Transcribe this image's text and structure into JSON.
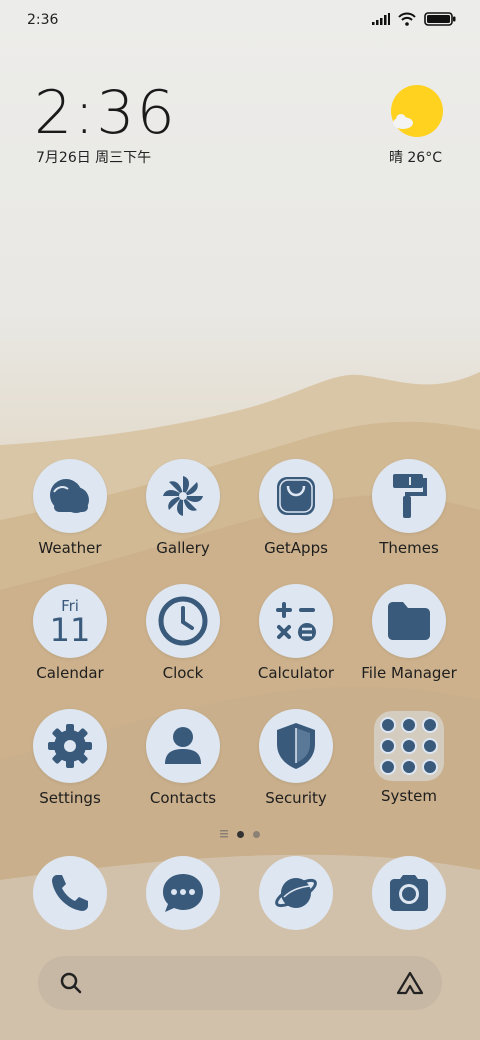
{
  "status_bar": {
    "time": "2:36"
  },
  "clock_widget": {
    "time": "2:36",
    "date": "7月26日 周三下午"
  },
  "weather_widget": {
    "text": "晴 26°C"
  },
  "apps": [
    {
      "label": "Weather",
      "icon": "cloud-icon"
    },
    {
      "label": "Gallery",
      "icon": "pinwheel-icon"
    },
    {
      "label": "GetApps",
      "icon": "shopping-bag-icon"
    },
    {
      "label": "Themes",
      "icon": "paint-roller-icon"
    },
    {
      "label": "Calendar",
      "icon": "calendar-icon",
      "day": "Fri",
      "date": "11"
    },
    {
      "label": "Clock",
      "icon": "clock-icon"
    },
    {
      "label": "Calculator",
      "icon": "calculator-icon"
    },
    {
      "label": "File Manager",
      "icon": "folder-icon"
    },
    {
      "label": "Settings",
      "icon": "gear-icon"
    },
    {
      "label": "Contacts",
      "icon": "person-icon"
    },
    {
      "label": "Security",
      "icon": "shield-icon"
    },
    {
      "label": "System",
      "icon": "folder-group-icon"
    }
  ],
  "dock": [
    {
      "icon": "phone-icon"
    },
    {
      "icon": "message-icon"
    },
    {
      "icon": "browser-planet-icon"
    },
    {
      "icon": "camera-icon"
    }
  ],
  "colors": {
    "icon_fg": "#3a5a7c",
    "icon_bg": "#dde6f1",
    "weather_sun": "#ffd21f"
  }
}
